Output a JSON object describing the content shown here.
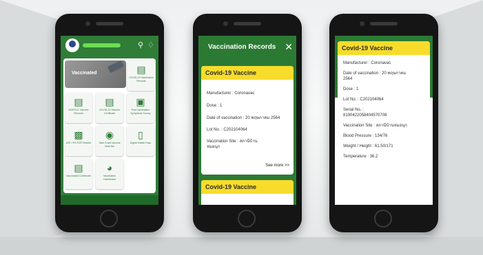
{
  "phone1": {
    "banner_label": "Vaccinated",
    "header_icons": [
      "search-icon",
      "bell-icon"
    ],
    "tiles": [
      {
        "label": "COVID-19 Vaccination Records",
        "icon": "document-icon"
      },
      {
        "label": "MOPH-IC Vaccine Records",
        "icon": "document-icon"
      },
      {
        "label": "COVID-19 Vaccine Certificate",
        "icon": "document-icon"
      },
      {
        "label": "Post Vaccination Symptoms Survey",
        "icon": "clipboard-icon"
      },
      {
        "label": "ATK / RT-PCR Results",
        "icon": "chart-icon"
      },
      {
        "label": "Take Covid Vaccine Near Me",
        "icon": "location-icon"
      },
      {
        "label": "Digital Health Pass",
        "icon": "phone-icon"
      },
      {
        "label": "Vaccination Certificate",
        "icon": "document-icon"
      },
      {
        "label": "Vaccination Dashboard",
        "icon": "dashboard-icon"
      }
    ]
  },
  "phone2": {
    "title": "Vaccination Records",
    "close_icon": "close-icon",
    "card1": {
      "heading": "Covid-19 Vaccine",
      "manufacturer": "Manufacturer : Coronavac",
      "dose": "Dose : 1",
      "date": "Date of vaccination : 20 พฤษภาคม 2564",
      "lot": "Lot No. : C202104064",
      "site": "Vaccination Site : สถานีบ้านหมอนุก",
      "see_more": "See more >>"
    },
    "card2": {
      "heading": "Covid-19 Vaccine"
    }
  },
  "phone3": {
    "heading": "Covid-19 Vaccine",
    "rows": [
      "Manufacturer : Coronavac",
      "Date of vaccination : 20 พฤษภาคม 2564",
      "Dose : 1",
      "Lot No. : C202104064",
      "Serial No. : 8190422058404570708",
      "Vaccination Site : สถานีบ้านหมอนุก",
      "Blood Pressure : 134/76",
      "Weight / Height : 61.50/171",
      "Temperature : 36.2"
    ]
  }
}
